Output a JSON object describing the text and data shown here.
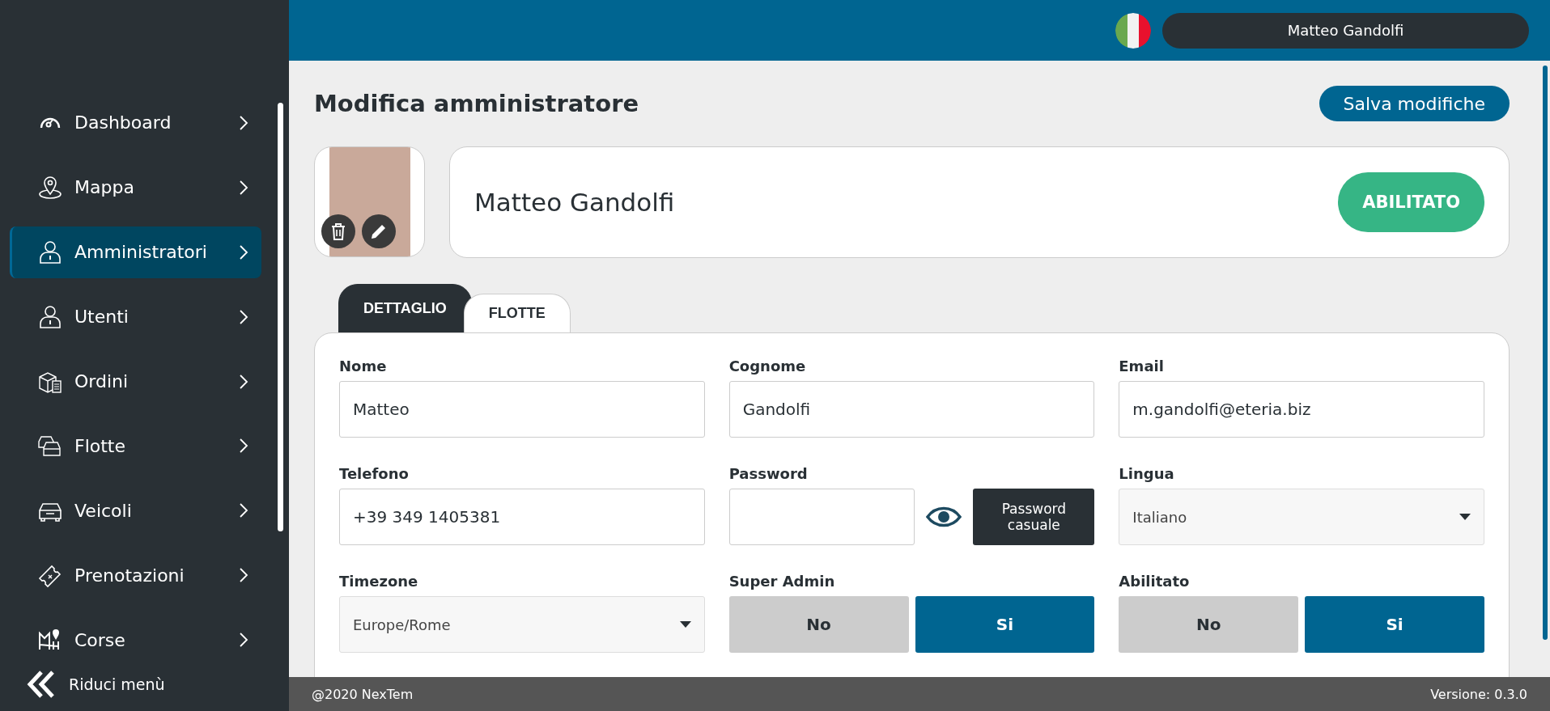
{
  "sidebar": {
    "items": [
      {
        "label": "Dashboard",
        "kind": "gauge",
        "selected": false
      },
      {
        "label": "Mappa",
        "kind": "pin",
        "selected": false
      },
      {
        "label": "Amministratori",
        "kind": "person",
        "selected": true
      },
      {
        "label": "Utenti",
        "kind": "person",
        "selected": false
      },
      {
        "label": "Ordini",
        "kind": "box",
        "selected": false
      },
      {
        "label": "Flotte",
        "kind": "cars",
        "selected": false
      },
      {
        "label": "Veicoli",
        "kind": "car",
        "selected": false
      },
      {
        "label": "Prenotazioni",
        "kind": "ticket",
        "selected": false
      },
      {
        "label": "Corse",
        "kind": "map",
        "selected": false
      }
    ],
    "collapse_label": "Riduci menù"
  },
  "header": {
    "user_name": "Matteo Gandolfi"
  },
  "page": {
    "title": "Modifica amministratore",
    "save_button": "Salva modifiche"
  },
  "profile": {
    "name": "Matteo Gandolfi",
    "status": "ABILITATO"
  },
  "tabs": [
    {
      "label": "DETTAGLIO",
      "selected": true
    },
    {
      "label": "FLOTTE",
      "selected": false
    }
  ],
  "form": {
    "fields": [
      {
        "kind": "text",
        "label": "Nome",
        "value": "Matteo"
      },
      {
        "kind": "text",
        "label": "Cognome",
        "value": "Gandolfi"
      },
      {
        "kind": "text",
        "label": "Email",
        "value": "m.gandolfi@eteria.biz"
      },
      {
        "kind": "text",
        "label": "Telefono",
        "value": "+39 349 1405381"
      },
      {
        "kind": "password",
        "label": "Password",
        "button": "Password casuale"
      },
      {
        "kind": "select",
        "label": "Lingua",
        "value": "Italiano"
      },
      {
        "kind": "select",
        "label": "Timezone",
        "value": "Europe/Rome"
      },
      {
        "kind": "toggle",
        "label": "Super Admin",
        "options": [
          {
            "label": "No",
            "selected": false
          },
          {
            "label": "Si",
            "selected": true
          }
        ]
      },
      {
        "kind": "toggle",
        "label": "Abilitato",
        "options": [
          {
            "label": "No",
            "selected": false
          },
          {
            "label": "Si",
            "selected": true
          }
        ]
      }
    ]
  },
  "footer": {
    "copyright": "@2020 NexTem",
    "version": "Versione: 0.3.0"
  }
}
